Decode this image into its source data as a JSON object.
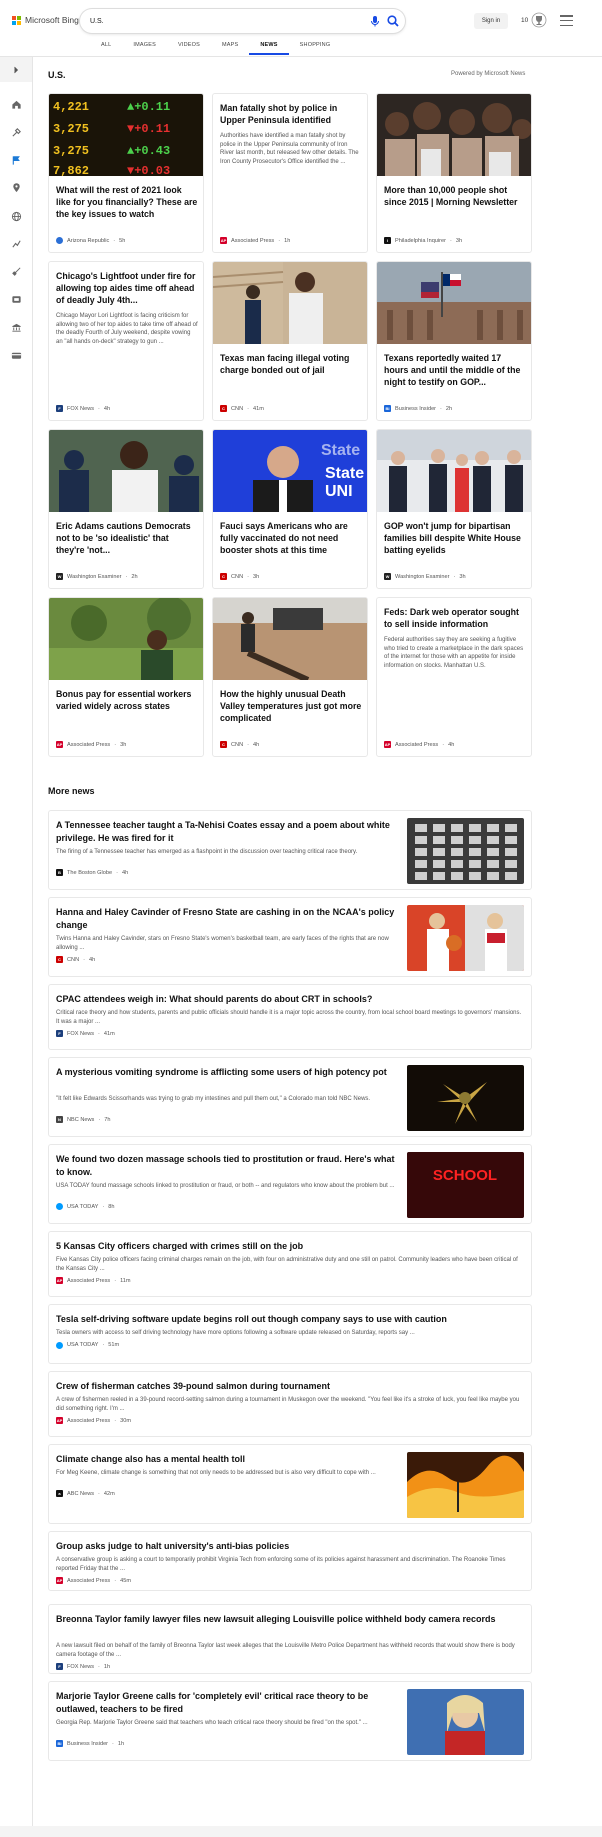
{
  "brand": {
    "name": "Microsoft Bing",
    "colors": [
      "#f25022",
      "#7fba00",
      "#00a4ef",
      "#ffb900"
    ]
  },
  "search": {
    "value": "U.S."
  },
  "header": {
    "signin_label": "Sign in",
    "rewards_points": "10"
  },
  "tabs": [
    {
      "label": "ALL"
    },
    {
      "label": "IMAGES"
    },
    {
      "label": "VIDEOS"
    },
    {
      "label": "MAPS"
    },
    {
      "label": "NEWS",
      "active": true
    },
    {
      "label": "SHOPPING"
    }
  ],
  "rail_icons": [
    "chevron-right-icon",
    "home-icon",
    "tools-icon",
    "flag-icon",
    "location-pin-icon",
    "globe-icon",
    "chart-icon",
    "rocket-icon",
    "film-icon",
    "building-icon",
    "credit-card-icon"
  ],
  "main": {
    "section_title": "U.S.",
    "powered_by": "Powered by Microsoft News"
  },
  "cards": [
    {
      "title": "What will the rest of 2021 look like for you financially? These are the key issues to watch",
      "source": "Arizona Republic",
      "time": "5h",
      "image": "stock-ticker-board"
    },
    {
      "title": "Man fatally shot by police in Upper Peninsula identified",
      "snippet": "Authorities have identified a man fatally shot by police in the Upper Peninsula community of Iron River last month, but released few other details. The Iron County Prosecutor's Office identified the ...",
      "source": "Associated Press",
      "time": "1h"
    },
    {
      "title": "More than 10,000 people shot since 2015 | Morning Newsletter",
      "source": "Philadelphia Inquirer",
      "time": "3h",
      "image": "crowd-gathering"
    },
    {
      "title": "Chicago's Lightfoot under fire for allowing top aides time off ahead of deadly July 4th...",
      "snippet": "Chicago Mayor Lori Lightfoot is facing criticism for allowing two of her top aides to take time off ahead of the deadly Fourth of July weekend, despite vowing an \"all hands on-deck\" strategy to gun ...",
      "source": "FOX News",
      "time": "4h"
    },
    {
      "title": "Texas man facing illegal voting charge bonded out of jail",
      "source": "CNN",
      "time": "41m",
      "image": "man-outside-courthouse"
    },
    {
      "title": "Texans reportedly waited 17 hours and until the middle of the night to testify on GOP...",
      "source": "Business Insider",
      "time": "2h",
      "image": "texas-capitol"
    },
    {
      "title": "Eric Adams cautions Democrats not to be 'so idealistic' that they're 'not...",
      "source": "Washington Examiner",
      "time": "2h",
      "image": "politician-with-police"
    },
    {
      "title": "Fauci says Americans who are fully vaccinated do not need booster shots at this time",
      "source": "CNN",
      "time": "3h",
      "image": "fauci-interview"
    },
    {
      "title": "GOP won't jump for bipartisan families bill despite White House batting eyelids",
      "source": "Washington Examiner",
      "time": "3h",
      "image": "white-house-group"
    },
    {
      "title": "Bonus pay for essential workers varied widely across states",
      "source": "Associated Press",
      "time": "3h",
      "image": "worker-in-park"
    },
    {
      "title": "How the highly unusual Death Valley temperatures just got more complicated",
      "source": "CNN",
      "time": "4h",
      "image": "desert-tourist"
    },
    {
      "title": "Feds: Dark web operator sought to sell inside information",
      "snippet": "Federal authorities say they are seeking a fugitive who tried to create a marketplace in the dark spaces of the internet for those with an appetite for inside information on stocks. Manhattan U.S.",
      "source": "Associated Press",
      "time": "4h"
    }
  ],
  "more_news_title": "More news",
  "more_news": [
    {
      "title": "A Tennessee teacher taught a Ta-Nehisi Coates essay and a poem about white privilege. He was fired for it",
      "snippet": "The firing of a Tennessee teacher has emerged as a flashpoint in the discussion over teaching critical race theory.",
      "source": "The Boston Globe",
      "time": "4h",
      "image": "empty-classroom"
    },
    {
      "title": "Hanna and Haley Cavinder of Fresno State are cashing in on the NCAA's policy change",
      "snippet": "Twins Hanna and Haley Cavinder, stars on Fresno State's women's basketball team, are early faces of the rights that are now allowing ...",
      "source": "CNN",
      "time": "4h",
      "image": "basketball-players"
    },
    {
      "title": "CPAC attendees weigh in: What should parents do about CRT in schools?",
      "snippet": "Critical race theory and how students, parents and public officials should handle it is a major topic across the country, from local school board meetings to governors' mansions.  It was a major ...",
      "source": "FOX News",
      "time": "41m"
    },
    {
      "title": "A mysterious vomiting syndrome is afflicting some users of high potency pot",
      "snippet": "\"It felt like Edwards Scissorhands was trying to grab my intestines and pull them out,\" a Colorado man told NBC News.",
      "source": "NBC News",
      "time": "7h",
      "image": "cannabis-plant"
    },
    {
      "title": "We found two dozen massage schools tied to prostitution or fraud. Here's what to know.",
      "snippet": "USA TODAY found massage schools linked to prostitution or fraud, or both -- and regulators who know about the problem but ...",
      "source": "USA TODAY",
      "time": "8h",
      "image": "school-neon-sign",
      "image_text": "SCHOOL"
    },
    {
      "title": "5 Kansas City officers charged with crimes still on the job",
      "snippet": "Five Kansas City police officers facing criminal charges remain on the job, with four on administrative duty and one still on patrol. Community leaders who have been critical of the Kansas City ...",
      "source": "Associated Press",
      "time": "11m"
    },
    {
      "title": "Tesla self-driving software update begins roll out though company says to use with caution",
      "snippet": "Tesla owners with access to self driving technology have more options following a software update released on Saturday, reports say ...",
      "source": "USA TODAY",
      "time": "51m"
    },
    {
      "title": "Crew of fisherman catches 39-pound salmon during tournament",
      "snippet": "A crew of fishermen reeled in a 39-pound record-setting salmon during a tournament in Muskegon over the weekend. \"You feel like it's a stroke of luck, you feel like maybe you did something right. I'm ...",
      "source": "Associated Press",
      "time": "30m"
    },
    {
      "title": "Climate change also has a mental health toll",
      "snippet": "For Meg Keene, climate change is something that not only needs to be addressed but is also very difficult to cope with ...",
      "source": "ABC News",
      "time": "42m",
      "image": "wildfire"
    },
    {
      "title": "Group asks judge to halt university's anti-bias policies",
      "snippet": "A conservative group is asking a court to temporarily prohibit Virginia Tech from enforcing some of its policies against harassment and discrimination. The Roanoke Times reported Friday that the ...",
      "source": "Associated Press",
      "time": "45m"
    },
    {
      "title": "Breonna Taylor family lawyer files new lawsuit alleging Louisville police withheld body camera records",
      "snippet": "A new lawsuit filed on behalf of the family of Breonna Taylor last week alleges that the Louisville Metro Police Department has withheld records that would show there is body camera footage of the ...",
      "source": "FOX News",
      "time": "1h"
    },
    {
      "title": "Marjorie Taylor Greene calls for 'completely evil' critical race theory to be outlawed, teachers to be fired",
      "snippet": "Georgia Rep. Marjorie Taylor Greene said that teachers who teach critical race theory should be fired \"on the spot.\" ...",
      "source": "Business Insider",
      "time": "1h",
      "image": "speaker-portrait"
    }
  ],
  "sources": {
    "Arizona Republic": {
      "abbr": "",
      "color": "#2b6fd6"
    },
    "Associated Press": {
      "abbr": "AP",
      "color": "#d4002a"
    },
    "Philadelphia Inquirer": {
      "abbr": "I",
      "color": "#111111"
    },
    "FOX News": {
      "abbr": "F",
      "color": "#1c3f7c"
    },
    "CNN": {
      "abbr": "CNN",
      "color": "#cc0000"
    },
    "Business Insider": {
      "abbr": "BI",
      "color": "#1a66d9"
    },
    "Washington Examiner": {
      "abbr": "W",
      "color": "#222222"
    },
    "The Boston Globe": {
      "abbr": "B",
      "color": "#111111"
    },
    "NBC News": {
      "abbr": "N",
      "color": "#444444"
    },
    "USA TODAY": {
      "abbr": "",
      "color": "#009bff"
    },
    "ABC News": {
      "abbr": "abc",
      "color": "#111111"
    }
  }
}
